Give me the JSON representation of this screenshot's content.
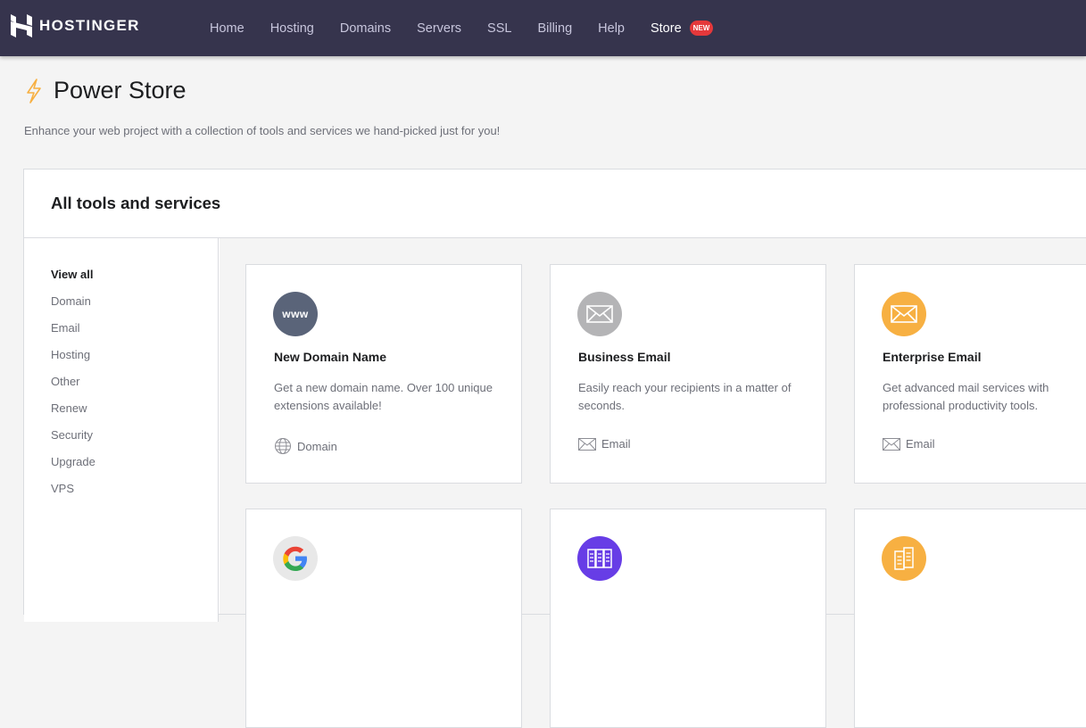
{
  "brand": {
    "name": "HOSTINGER"
  },
  "nav": {
    "items": [
      "Home",
      "Hosting",
      "Domains",
      "Servers",
      "SSL",
      "Billing",
      "Help"
    ],
    "store": "Store",
    "store_badge": "NEW"
  },
  "page": {
    "title": "Power Store",
    "subtitle": "Enhance your web project with a collection of tools and services we hand-picked just for you!"
  },
  "panel": {
    "title": "All tools and services",
    "categories": [
      "View all",
      "Domain",
      "Email",
      "Hosting",
      "Other",
      "Renew",
      "Security",
      "Upgrade",
      "VPS"
    ],
    "active_category": "View all"
  },
  "products": [
    {
      "name": "New Domain Name",
      "description": "Get a new domain name. Over 100 unique extensions available!",
      "category": "Domain",
      "icon": "www-icon",
      "icon_text": "www",
      "color": "#5a6479"
    },
    {
      "name": "Business Email",
      "description": "Easily reach your recipients in a matter of seconds.",
      "category": "Email",
      "icon": "envelope-icon",
      "color": "#b4b4b6"
    },
    {
      "name": "Enterprise Email",
      "description": "Get advanced mail services with professional productivity tools.",
      "category": "Email",
      "icon": "envelope-icon",
      "color": "#f7b042"
    },
    {
      "icon": "google-icon",
      "color": "#e8e8e8"
    },
    {
      "icon": "server-icon",
      "color": "#673de6"
    },
    {
      "icon": "server-icon",
      "color": "#f7b042"
    }
  ]
}
